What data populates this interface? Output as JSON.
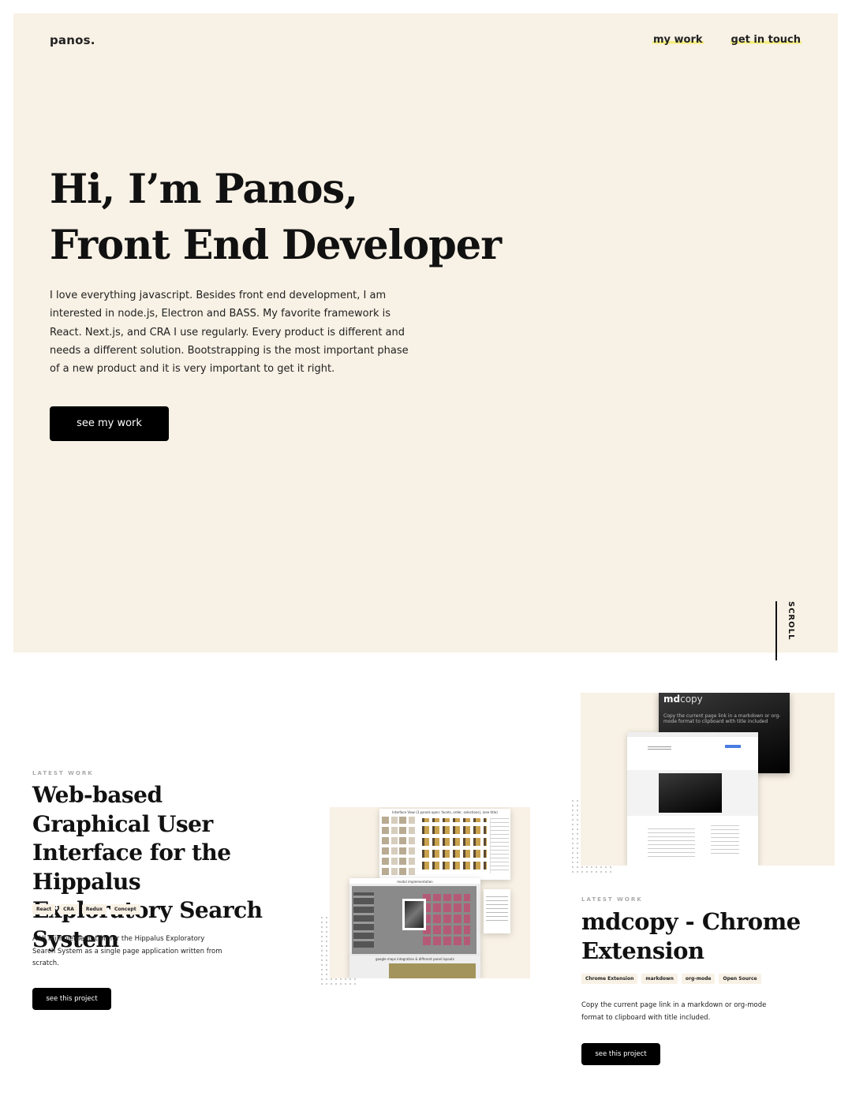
{
  "logo": "panos.",
  "nav": {
    "my_work": "my work",
    "get_in_touch": "get in touch"
  },
  "hero": {
    "title_line1": "Hi, I’m Panos,",
    "title_line2": "Front End Developer",
    "description": "I love everything javascript. Besides front end development, I am interested in node.js, Electron and BASS. My favorite framework is React. Next.js, and CRA I use regularly. Every product is different and needs a different solution. Bootstrapping is the most important phase of a new product and it is very important to get it right.",
    "cta": "see my work",
    "scroll": "SCROLL"
  },
  "projects": [
    {
      "eyebrow": "LATEST WORK",
      "title": "Web-based Graphical User Interface for the Hippalus Exploratory Search System",
      "tags": [
        "React",
        "CRA",
        "Redux",
        "Concept"
      ],
      "description": "A UI reimplementation for the Hippalus Exploratory Search System as a single page application written from scratch.",
      "cta": "see this project",
      "thumb_labels": [
        "Interface View (3 panels open: facets, order, selections), (see title)",
        "modal implementation",
        "google maps integration & different panel layouts"
      ]
    },
    {
      "eyebrow": "LATEST WORK",
      "title": "mdcopy - Chrome Extension",
      "tags": [
        "Chrome Extension",
        "markdown",
        "org-mode",
        "Open Source"
      ],
      "description": "Copy the current page link in a markdown or org-mode format to clipboard with title included.",
      "cta": "see this project",
      "thumb_brand_bold": "md",
      "thumb_brand_light": "copy",
      "thumb_caption": "Copy the current page link in a markdown or org-mode format to clipboard with title included"
    }
  ],
  "colors": {
    "hero_bg": "#f8f1e5",
    "highlight": "#f3ee7a",
    "button": "#000000"
  }
}
